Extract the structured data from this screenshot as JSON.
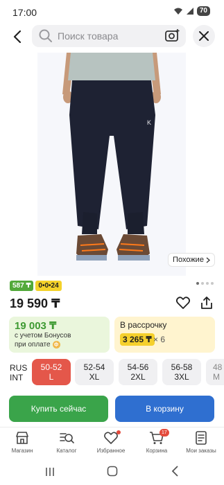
{
  "status_bar": {
    "time": "17:00",
    "battery": "70"
  },
  "search": {
    "placeholder": "Поиск товара"
  },
  "product": {
    "similar_label": "Похожие",
    "badges": {
      "bonus": "587 ₸",
      "installment": "0•0•24"
    },
    "price": "19 590 ₸"
  },
  "bonus_card": {
    "amount": "19 003 ₸",
    "line1": "с учетом Бонусов",
    "line2": "при оплате"
  },
  "installment_card": {
    "title": "В рассрочку",
    "amount": "3 265 ₸",
    "multiplier": "× 6"
  },
  "sizes": {
    "label_rus": "RUS",
    "label_int": "INT",
    "options": [
      {
        "rus": "50-52",
        "int": "L"
      },
      {
        "rus": "52-54",
        "int": "XL"
      },
      {
        "rus": "54-56",
        "int": "2XL"
      },
      {
        "rus": "56-58",
        "int": "3XL"
      },
      {
        "rus": "48",
        "int": "M"
      }
    ]
  },
  "actions": {
    "buy": "Купить сейчас",
    "cart": "В корзину"
  },
  "nav": {
    "store": "Магазин",
    "catalog": "Каталог",
    "favorites": "Избранное",
    "cart": "Корзина",
    "cart_count": "17",
    "orders": "Мои заказы"
  },
  "colors": {
    "buy": "#3aa44a",
    "cart": "#2f6fd0",
    "selected_size": "#e4574a",
    "bonus_green": "#3e9a32"
  }
}
